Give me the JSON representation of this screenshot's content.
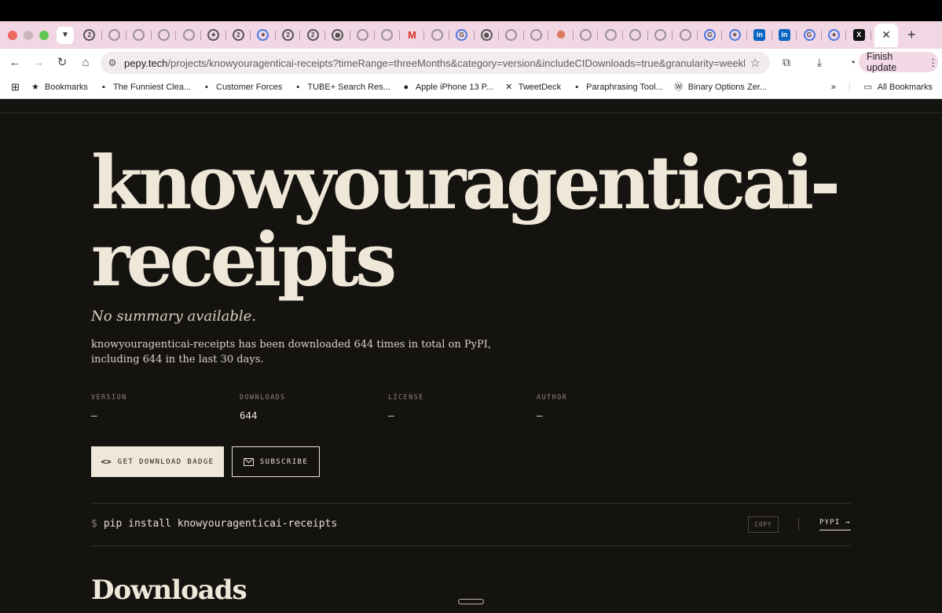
{
  "browser": {
    "url_host": "pepy.tech",
    "url_path": "/projects/knowyouragenticai-receipts?timeRange=threeMonths&category=version&includeCIDownloads=true&granularity=weekly&vie...",
    "finish_update": "Finish update",
    "tab_icons": [
      "2-icon",
      "loading-icon",
      "globe-icon",
      "globe-icon",
      "globe-icon",
      "sparkle-icon",
      "2-icon",
      "gemini-icon",
      "2-icon",
      "2-icon",
      "chrome-icon",
      "github-icon",
      "globe-icon",
      "gmail-icon",
      "github-icon",
      "google-icon",
      "chrome-icon",
      "globe-icon",
      "globe-icon",
      "claude-icon",
      "globe-icon",
      "globe-icon",
      "globe-icon",
      "globe-icon",
      "globe-icon",
      "google-icon",
      "gemini-icon",
      "linkedin-icon",
      "linkedin-icon",
      "google-icon",
      "gemini-icon",
      "x-icon"
    ]
  },
  "bookmarks": {
    "items": [
      {
        "icon": "star-icon",
        "label": "Bookmarks"
      },
      {
        "icon": "favicon",
        "label": "The Funniest Clea..."
      },
      {
        "icon": "favicon",
        "label": "Customer Forces"
      },
      {
        "icon": "favicon",
        "label": "TUBE+ Search Res..."
      },
      {
        "icon": "apple-icon",
        "label": "Apple iPhone 13 P..."
      },
      {
        "icon": "x-icon",
        "label": "TweetDeck"
      },
      {
        "icon": "favicon",
        "label": "Paraphrasing Tool..."
      },
      {
        "icon": "wordpress-icon",
        "label": "Binary Options Zer..."
      }
    ],
    "overflow": "»",
    "all_bookmarks": "All Bookmarks"
  },
  "page": {
    "title_line1": "knowyouragenticai-",
    "title_line2": "receipts",
    "summary": "No summary available.",
    "description": "knowyouragenticai-receipts has been downloaded 644 times in total on PyPI, including 644 in the last 30 days.",
    "stats": [
      {
        "label": "VERSION",
        "value": "—"
      },
      {
        "label": "DOWNLOADS",
        "value": "644"
      },
      {
        "label": "LICENSE",
        "value": "—"
      },
      {
        "label": "AUTHOR",
        "value": "—"
      }
    ],
    "badge_button": "GET DOWNLOAD BADGE",
    "subscribe_button": "SUBSCRIBE",
    "install_prompt": "$",
    "install_command": "pip install knowyouragenticai-receipts",
    "copy": "COPY",
    "pypi": "PYPI →",
    "section_title": "Downloads"
  }
}
